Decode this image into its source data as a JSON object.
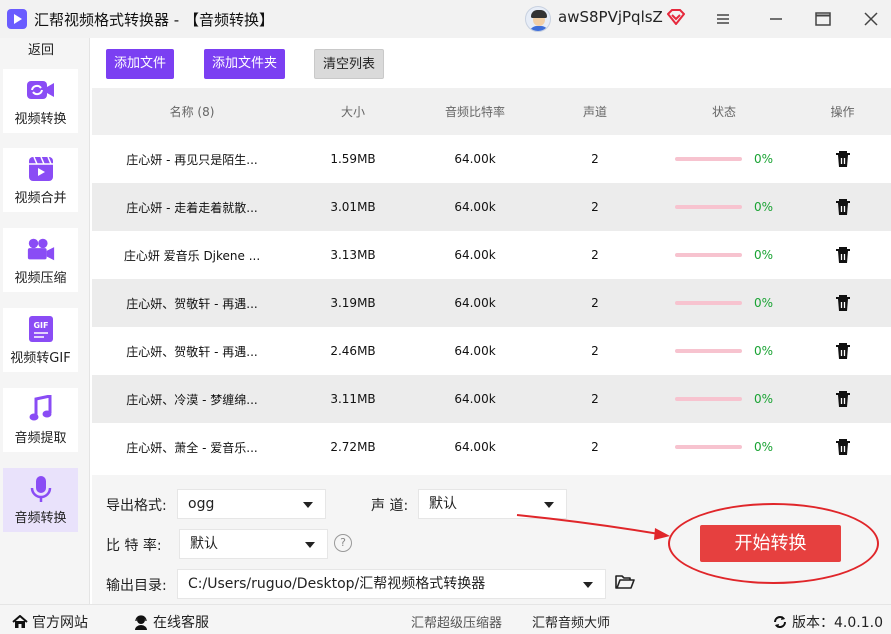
{
  "window": {
    "title": "汇帮视频格式转换器 - 【音频转换】",
    "user_name": "awS8PVjPqlsZ",
    "accent_color": "#7b3ff2"
  },
  "sidebar": {
    "back_label": "返回",
    "items": [
      {
        "label": "视频转换",
        "icon": "video-convert-icon",
        "active": false
      },
      {
        "label": "视频合并",
        "icon": "video-merge-icon",
        "active": false
      },
      {
        "label": "视频压缩",
        "icon": "video-compress-icon",
        "active": false
      },
      {
        "label": "视频转GIF",
        "icon": "gif-icon",
        "active": false
      },
      {
        "label": "音频提取",
        "icon": "music-note-icon",
        "active": false
      },
      {
        "label": "音频转换",
        "icon": "microphone-icon",
        "active": true
      }
    ]
  },
  "toolbar": {
    "add_file": "添加文件",
    "add_folder": "添加文件夹",
    "clear_list": "清空列表"
  },
  "table": {
    "headers": {
      "name": "名称 (8)",
      "size": "大小",
      "bitrate": "音频比特率",
      "channels": "声道",
      "status": "状态",
      "action": "操作"
    },
    "rows": [
      {
        "name": "庄心妍 - 再见只是陌生...",
        "size": "1.59MB",
        "bitrate": "64.00k",
        "channels": "2",
        "progress": 0,
        "progress_text": "0%"
      },
      {
        "name": "庄心妍 - 走着走着就散...",
        "size": "3.01MB",
        "bitrate": "64.00k",
        "channels": "2",
        "progress": 0,
        "progress_text": "0%"
      },
      {
        "name": "庄心妍 爱音乐 Djkene ...",
        "size": "3.13MB",
        "bitrate": "64.00k",
        "channels": "2",
        "progress": 0,
        "progress_text": "0%"
      },
      {
        "name": "庄心妍、贺敬轩 - 再遇...",
        "size": "3.19MB",
        "bitrate": "64.00k",
        "channels": "2",
        "progress": 0,
        "progress_text": "0%"
      },
      {
        "name": "庄心妍、贺敬轩 - 再遇...",
        "size": "2.46MB",
        "bitrate": "64.00k",
        "channels": "2",
        "progress": 0,
        "progress_text": "0%"
      },
      {
        "name": "庄心妍、冷漠 - 梦缠绵...",
        "size": "3.11MB",
        "bitrate": "64.00k",
        "channels": "2",
        "progress": 0,
        "progress_text": "0%"
      },
      {
        "name": "庄心妍、萧全 - 爱音乐...",
        "size": "2.72MB",
        "bitrate": "64.00k",
        "channels": "2",
        "progress": 0,
        "progress_text": "0%"
      }
    ]
  },
  "settings": {
    "format_label": "导出格式:",
    "format_value": "ogg",
    "channel_label": "声 道:",
    "channel_value": "默认",
    "bitrate_label": "比 特 率:",
    "bitrate_value": "默认",
    "help_symbol": "?",
    "output_label": "输出目录:",
    "output_path": "C:/Users/ruguo/Desktop/汇帮视频格式转换器",
    "start_button": "开始转换"
  },
  "footer": {
    "website": "官方网站",
    "support": "在线客服",
    "compressor": "汇帮超级压缩器",
    "audio_master": "汇帮音频大师",
    "version": "版本：4.0.1.0"
  }
}
